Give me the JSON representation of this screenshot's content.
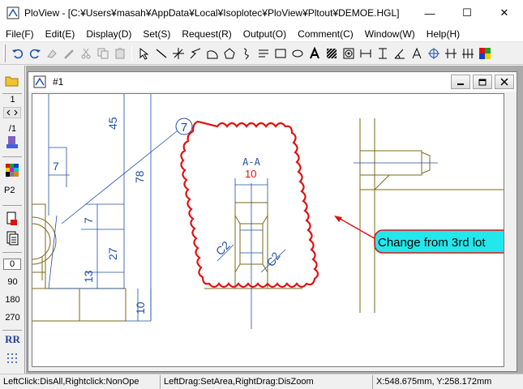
{
  "app": {
    "title": "PloView - [C:¥Users¥masah¥AppData¥Local¥Isoplotec¥PloView¥Pltout¥DEMOE.HGL]",
    "minimize": "—",
    "maximize": "☐",
    "close": "✕"
  },
  "menu": {
    "items": [
      {
        "label": "File(F)"
      },
      {
        "label": "Edit(E)"
      },
      {
        "label": "Display(D)"
      },
      {
        "label": "Set(S)"
      },
      {
        "label": "Request(R)"
      },
      {
        "label": "Output(O)"
      },
      {
        "label": "Comment(C)"
      },
      {
        "label": "Window(W)"
      },
      {
        "label": "Help(H)"
      }
    ]
  },
  "lefttool": {
    "page": "1",
    "page_ratio": "/1",
    "pen": "P2",
    "rotations": [
      "0",
      "90",
      "180",
      "270"
    ],
    "mirror": "RR"
  },
  "child": {
    "title": "#1"
  },
  "drawing": {
    "dim_45": "45",
    "dim_78": "78",
    "dim_7a": "7",
    "dim_7b": "7",
    "dim_27": "27",
    "dim_13": "13",
    "dim_10": "10",
    "balloon": "7",
    "section": "A-A",
    "rev_mark": "10",
    "c2a": "C2",
    "c2b": "C2",
    "callout": "Change from 3rd lot"
  },
  "status": {
    "left": "LeftClick:DisAll,Rightclick:NonOpe",
    "middle": "LeftDrag:SetArea,RightDrag:DisZoom",
    "coords": "X:548.675mm, Y:258.172mm"
  },
  "colors": {
    "dimension_blue": "#1f4fa3",
    "part_olive": "#7a6a1a",
    "cloud_red": "#e01010",
    "callout_fill": "#22e8ee"
  }
}
